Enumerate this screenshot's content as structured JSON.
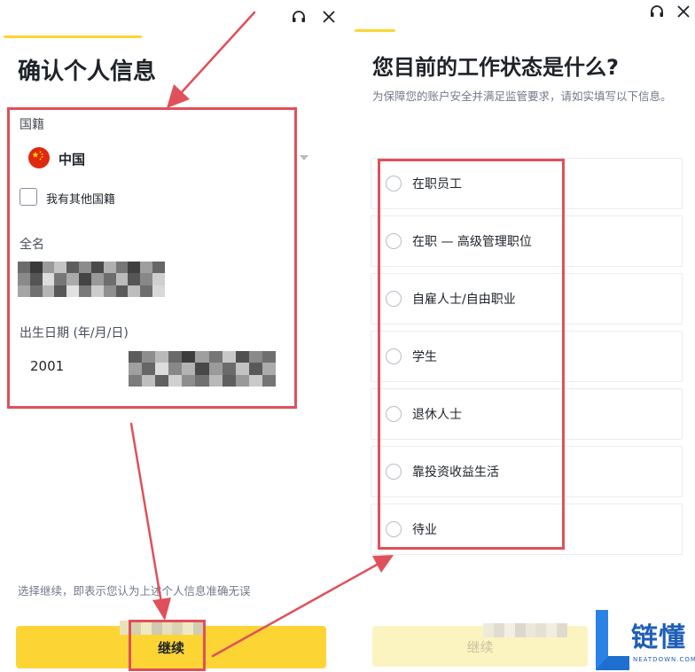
{
  "left": {
    "title": "确认个人信息",
    "nationality_label": "国籍",
    "nationality_value": "中国",
    "other_nationality_label": "我有其他国籍",
    "fullname_label": "全名",
    "dob_label": "出生日期 (年/月/日)",
    "dob_year": "2001",
    "disclaimer": "选择继续，即表示您认为上述个人信息准确无误",
    "continue_label": "继续"
  },
  "right": {
    "title": "您目前的工作状态是什么?",
    "subtitle": "为保障您的账户安全并满足监管要求，请如实填写以下信息。",
    "options": [
      {
        "label": "在职员工"
      },
      {
        "label": "在职 — 高级管理职位"
      },
      {
        "label": "自雇人士/自由职业"
      },
      {
        "label": "学生"
      },
      {
        "label": "退休人士"
      },
      {
        "label": "靠投资收益生活"
      },
      {
        "label": "待业"
      }
    ],
    "continue_label": "继续"
  },
  "icons": {
    "support": "headset-icon",
    "close": "close-icon",
    "flag": "china-flag-icon",
    "dropdown": "caret-down-icon"
  },
  "watermark": {
    "brand": "链懂",
    "domain": "NEATDOWN.COM"
  },
  "colors": {
    "accent": "#fcd535",
    "accent_disabled": "#fcf4c0",
    "annotation_red": "#e0505a"
  }
}
